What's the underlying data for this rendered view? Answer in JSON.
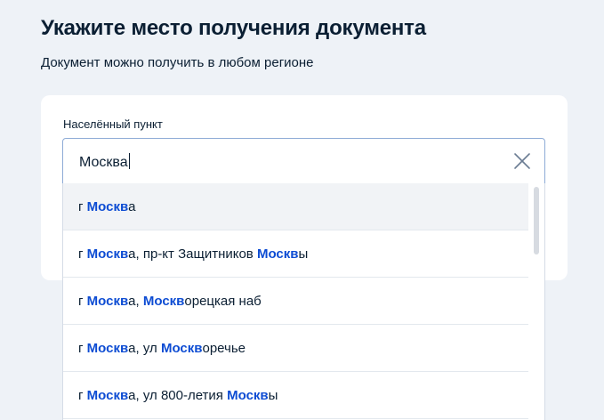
{
  "page": {
    "title": "Укажите место получения документа",
    "subtitle": "Документ можно получить в любом регионе"
  },
  "field": {
    "label": "Населённый пункт",
    "value": "Москва",
    "clear_icon": "close-icon"
  },
  "suggestions": [
    {
      "parts": [
        {
          "text": "г ",
          "hl": false
        },
        {
          "text": "Москв",
          "hl": true
        },
        {
          "text": "а",
          "hl": false
        }
      ]
    },
    {
      "parts": [
        {
          "text": "г ",
          "hl": false
        },
        {
          "text": "Москв",
          "hl": true
        },
        {
          "text": "а, пр-кт Защитников ",
          "hl": false
        },
        {
          "text": "Москв",
          "hl": true
        },
        {
          "text": "ы",
          "hl": false
        }
      ]
    },
    {
      "parts": [
        {
          "text": "г ",
          "hl": false
        },
        {
          "text": "Москв",
          "hl": true
        },
        {
          "text": "а, ",
          "hl": false
        },
        {
          "text": "Москв",
          "hl": true
        },
        {
          "text": "орецкая наб",
          "hl": false
        }
      ]
    },
    {
      "parts": [
        {
          "text": "г ",
          "hl": false
        },
        {
          "text": "Москв",
          "hl": true
        },
        {
          "text": "а, ул ",
          "hl": false
        },
        {
          "text": "Москв",
          "hl": true
        },
        {
          "text": "оречье",
          "hl": false
        }
      ]
    },
    {
      "parts": [
        {
          "text": "г ",
          "hl": false
        },
        {
          "text": "Москв",
          "hl": true
        },
        {
          "text": "а, ул 800-летия ",
          "hl": false
        },
        {
          "text": "Москв",
          "hl": true
        },
        {
          "text": "ы",
          "hl": false
        }
      ]
    }
  ],
  "colors": {
    "highlight": "#0d4cd3",
    "text": "#0b1f33",
    "background": "#eef2f7",
    "input_border": "#8dabd6"
  }
}
